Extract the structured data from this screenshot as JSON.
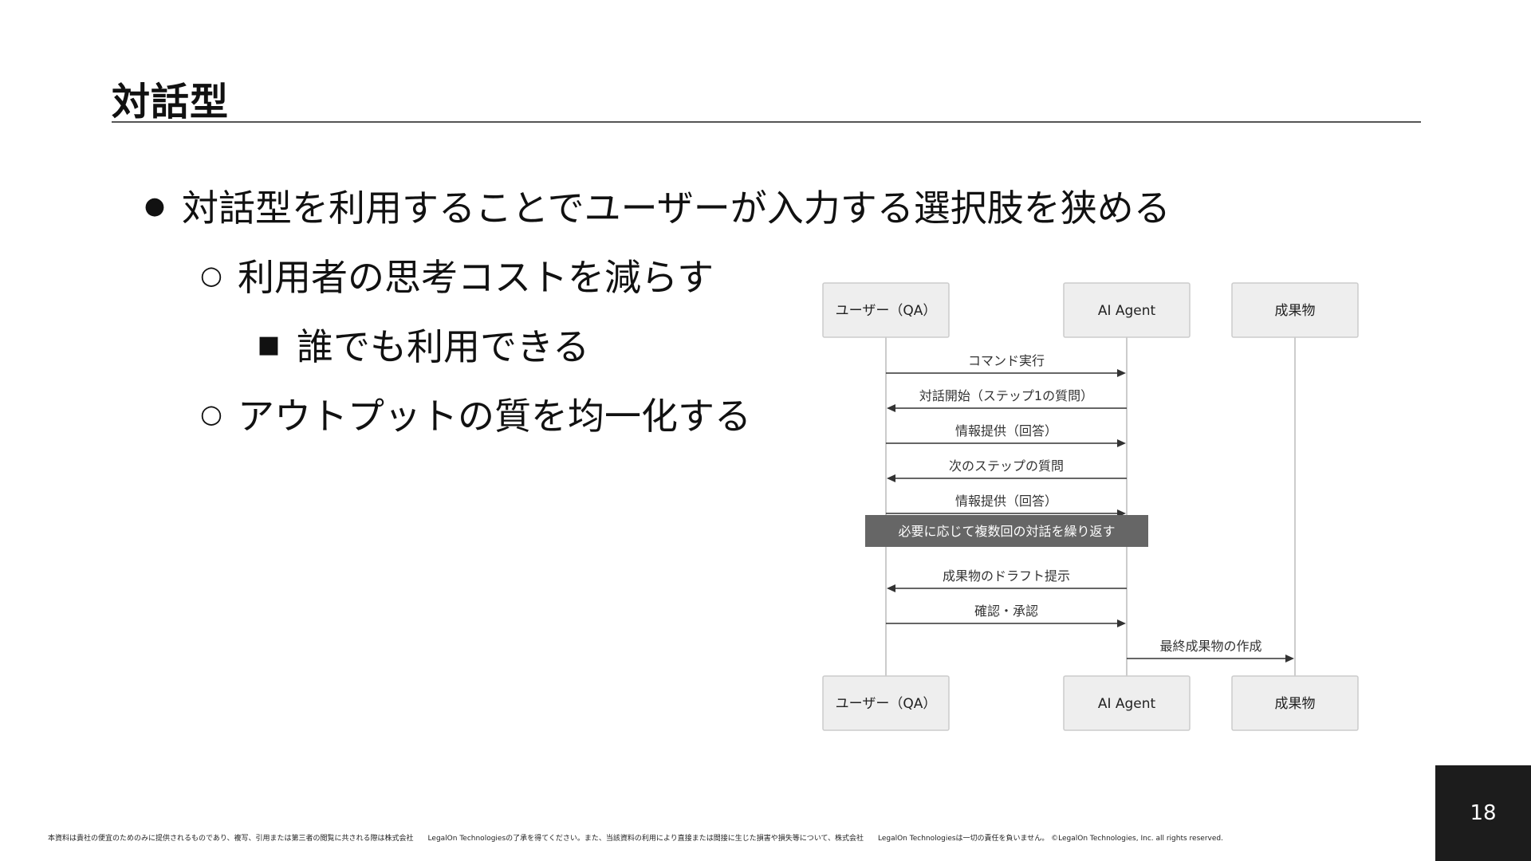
{
  "slide": {
    "title": "対話型",
    "page_number": "18",
    "footer": "本資料は貴社の便宜のためのみに提供されるものであり、複写、引用または第三者の閲覧に共される際は株式会社　　LegalOn Technologiesの了承を得てください。また、当該資料の利用により直接または間接に生じた損害や損失等について、株式会社　　LegalOn Technologiesは一切の責任を負いません。 ©LegalOn Technologies, Inc. all rights reserved."
  },
  "bullets": [
    {
      "marker": "●",
      "text": "対話型を利用することでユーザーが入力する選択肢を狭める"
    },
    {
      "marker": "○",
      "text": "利用者の思考コストを減らす"
    },
    {
      "marker": "■",
      "text": "誰でも利用できる"
    },
    {
      "marker": "○",
      "text": "アウトプットの質を均一化する"
    }
  ],
  "diagram": {
    "participants": [
      "ユーザー（QA）",
      "AI Agent",
      "成果物"
    ],
    "messages": [
      {
        "from": 0,
        "to": 1,
        "label": "コマンド実行"
      },
      {
        "from": 1,
        "to": 0,
        "label": "対話開始（ステップ1の質問）"
      },
      {
        "from": 0,
        "to": 1,
        "label": "情報提供（回答）"
      },
      {
        "from": 1,
        "to": 0,
        "label": "次のステップの質問"
      },
      {
        "from": 0,
        "to": 1,
        "label": "情報提供（回答）"
      },
      {
        "note": true,
        "label": "必要に応じて複数回の対話を繰り返す"
      },
      {
        "from": 1,
        "to": 0,
        "label": "成果物のドラフト提示"
      },
      {
        "from": 0,
        "to": 1,
        "label": "確認・承認"
      },
      {
        "from": 1,
        "to": 2,
        "label": "最終成果物の作成"
      }
    ]
  },
  "colors": {
    "box_fill": "#eeeeee",
    "box_stroke": "#cccccc",
    "lifeline": "#cccccc",
    "arrow": "#333333",
    "note_fill": "#666666",
    "note_text": "#ffffff"
  }
}
